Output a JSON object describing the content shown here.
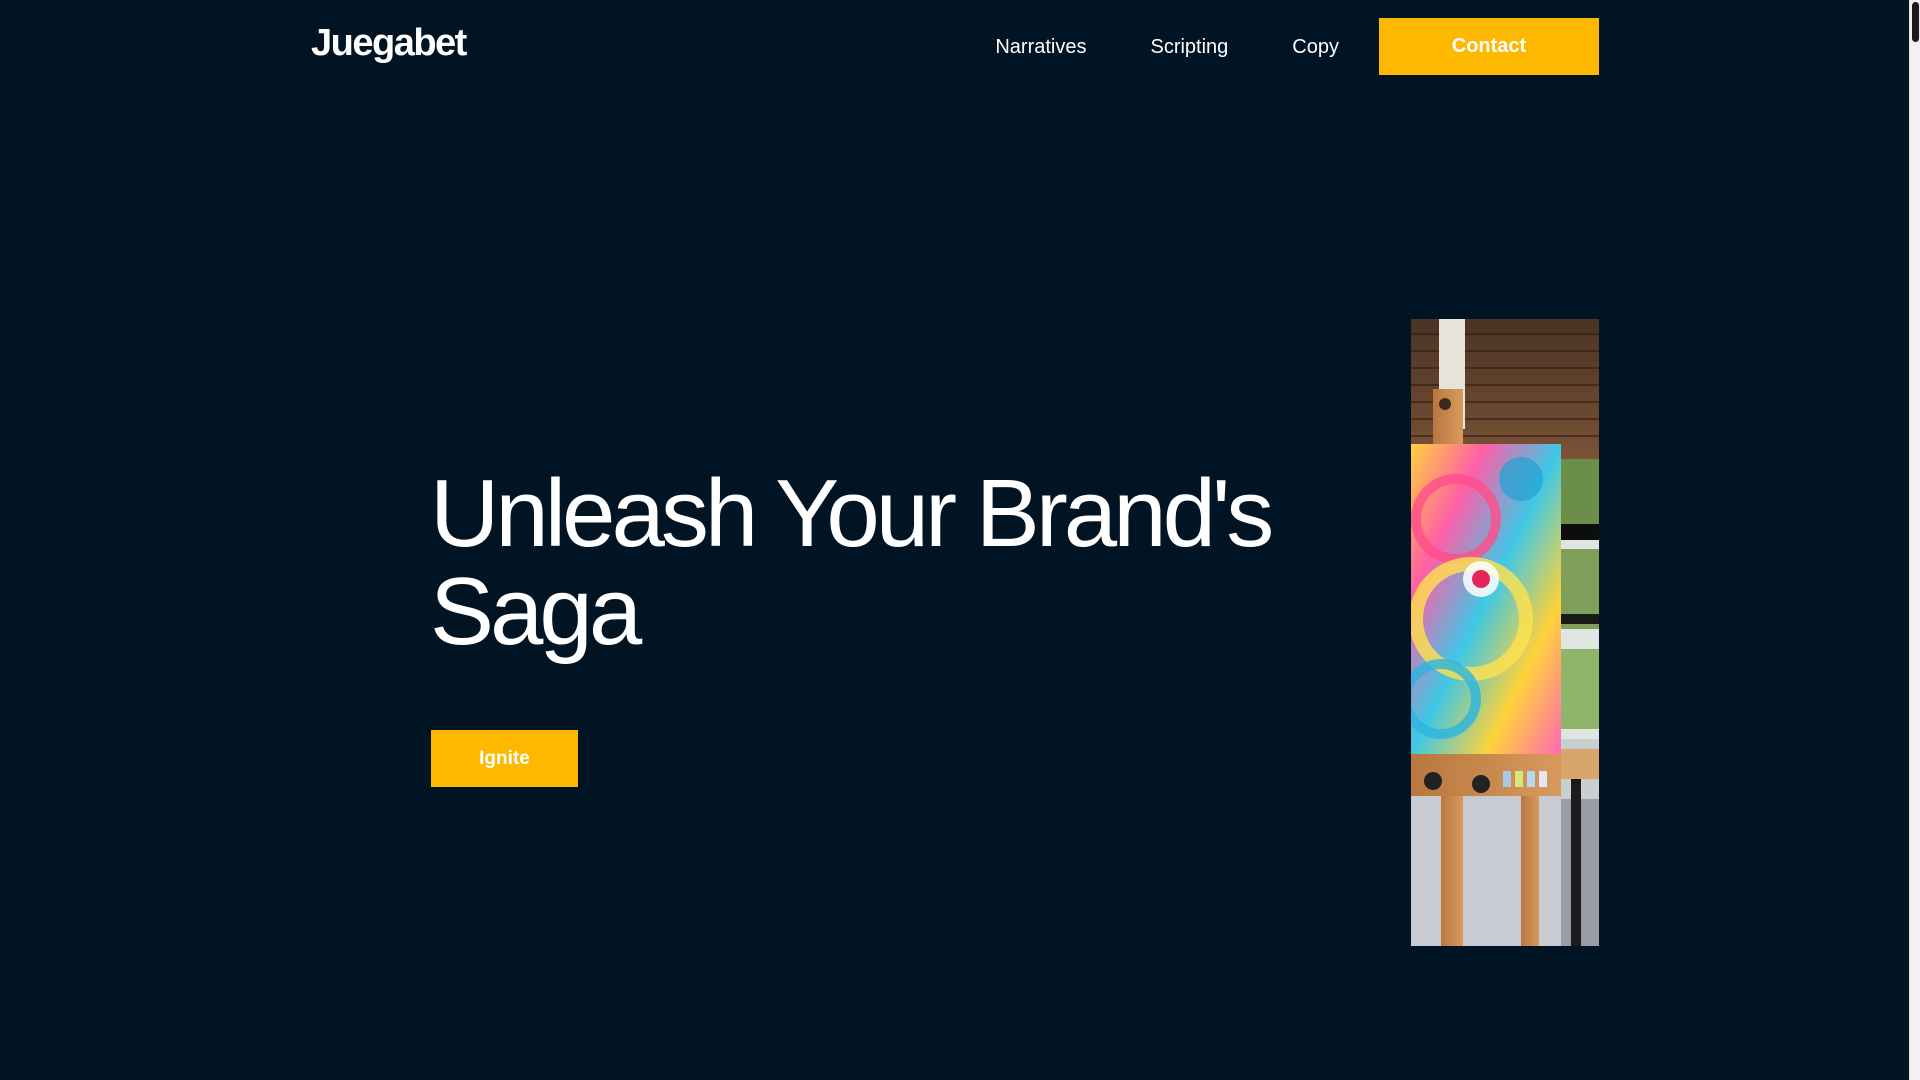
{
  "header": {
    "logo": "Juegabet",
    "nav": [
      {
        "label": "Narratives"
      },
      {
        "label": "Scripting"
      },
      {
        "label": "Copy"
      }
    ],
    "contact_label": "Contact"
  },
  "hero": {
    "title_line1": "Unleash Your Brand's",
    "title_line2": "Saga",
    "cta_label": "Ignite",
    "image_icon": "easel-painting-photo"
  },
  "colors": {
    "background": "#011423",
    "accent": "#ffb800",
    "text": "#ffffff"
  }
}
